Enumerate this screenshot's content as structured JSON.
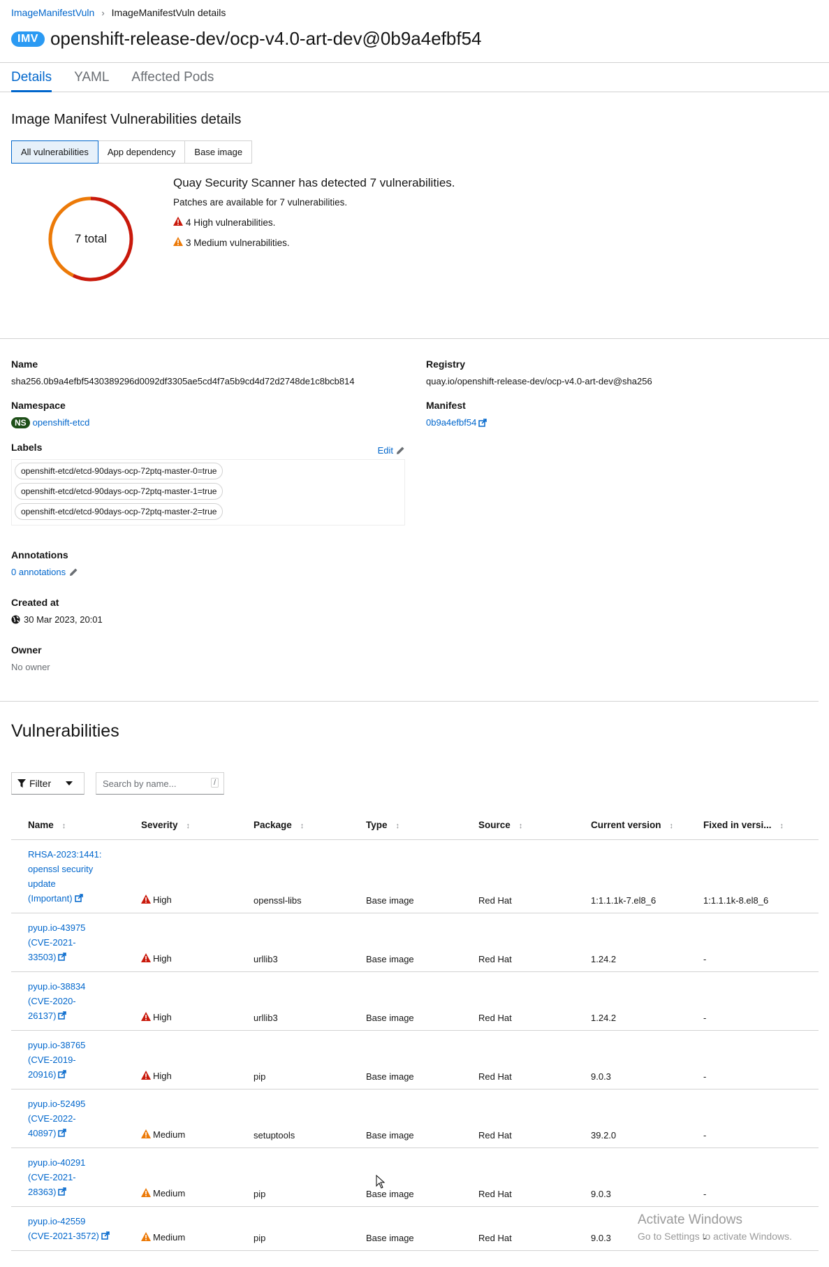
{
  "breadcrumb": {
    "parent": "ImageManifestVuln",
    "current": "ImageManifestVuln details"
  },
  "header": {
    "badge": "IMV",
    "title": "openshift-release-dev/ocp-v4.0-art-dev@0b9a4efbf54"
  },
  "tabs": [
    {
      "label": "Details"
    },
    {
      "label": "YAML"
    },
    {
      "label": "Affected Pods"
    }
  ],
  "details": {
    "heading": "Image Manifest Vulnerabilities details",
    "toggles": [
      {
        "label": "All vulnerabilities"
      },
      {
        "label": "App dependency"
      },
      {
        "label": "Base image"
      }
    ],
    "donut_label": "7 total",
    "donut_data": {
      "total": 7,
      "high": 4,
      "medium": 3,
      "high_color": "#c9190b",
      "medium_color": "#ec7a08"
    },
    "summary_title": "Quay Security Scanner has detected 7 vulnerabilities.",
    "patches": "Patches are available for 7 vulnerabilities.",
    "high_count": "4",
    "high_text": "High vulnerabilities.",
    "medium_count": "3",
    "medium_text": "Medium vulnerabilities."
  },
  "resource": {
    "name_label": "Name",
    "name_value": "sha256.0b9a4efbf5430389296d0092df3305ae5cd4f7a5b9cd4d72d2748de1c8bcb814",
    "registry_label": "Registry",
    "registry_value": "quay.io/openshift-release-dev/ocp-v4.0-art-dev@sha256",
    "namespace_label": "Namespace",
    "namespace_badge": "NS",
    "namespace_value": "openshift-etcd",
    "manifest_label": "Manifest",
    "manifest_value": "0b9a4efbf54",
    "labels_label": "Labels",
    "labels_edit": "Edit",
    "labels": [
      "openshift-etcd/etcd-90days-ocp-72ptq-master-0=true",
      "openshift-etcd/etcd-90days-ocp-72ptq-master-1=true",
      "openshift-etcd/etcd-90days-ocp-72ptq-master-2=true"
    ],
    "annotations_label": "Annotations",
    "annotations_value": "0 annotations",
    "created_label": "Created at",
    "created_value": "30 Mar 2023, 20:01",
    "owner_label": "Owner",
    "owner_value": "No owner"
  },
  "vulnerabilities": {
    "heading": "Vulnerabilities",
    "filter_label": "Filter",
    "search_placeholder": "Search by name...",
    "search_shortcut": "/",
    "columns": [
      "Name",
      "Severity",
      "Package",
      "Type",
      "Source",
      "Current version",
      "Fixed in versi..."
    ],
    "rows": [
      {
        "name": [
          "RHSA-2023:1441:",
          "openssl security",
          "update",
          "(Important)"
        ],
        "severity": "High",
        "package": "openssl-libs",
        "type": "Base image",
        "source": "Red Hat",
        "current": "1:1.1.1k-7.el8_6",
        "fixed": "1:1.1.1k-8.el8_6"
      },
      {
        "name": [
          "pyup.io-43975",
          "(CVE-2021-",
          "33503)"
        ],
        "severity": "High",
        "package": "urllib3",
        "type": "Base image",
        "source": "Red Hat",
        "current": "1.24.2",
        "fixed": "-"
      },
      {
        "name": [
          "pyup.io-38834",
          "(CVE-2020-",
          "26137)"
        ],
        "severity": "High",
        "package": "urllib3",
        "type": "Base image",
        "source": "Red Hat",
        "current": "1.24.2",
        "fixed": "-"
      },
      {
        "name": [
          "pyup.io-38765",
          "(CVE-2019-",
          "20916)"
        ],
        "severity": "High",
        "package": "pip",
        "type": "Base image",
        "source": "Red Hat",
        "current": "9.0.3",
        "fixed": "-"
      },
      {
        "name": [
          "pyup.io-52495",
          "(CVE-2022-",
          "40897)"
        ],
        "severity": "Medium",
        "package": "setuptools",
        "type": "Base image",
        "source": "Red Hat",
        "current": "39.2.0",
        "fixed": "-"
      },
      {
        "name": [
          "pyup.io-40291",
          "(CVE-2021-",
          "28363)"
        ],
        "severity": "Medium",
        "package": "pip",
        "type": "Base image",
        "source": "Red Hat",
        "current": "9.0.3",
        "fixed": "-"
      },
      {
        "name": [
          "pyup.io-42559",
          "(CVE-2021-3572)"
        ],
        "severity": "Medium",
        "package": "pip",
        "type": "Base image",
        "source": "Red Hat",
        "current": "9.0.3",
        "fixed": "-"
      }
    ]
  },
  "watermark": {
    "line1": "Activate Windows",
    "line2": "Go to Settings to activate Windows."
  },
  "colors": {
    "link": "#0066cc",
    "high": "#c9190b",
    "medium": "#ec7a08",
    "ns_badge": "#1e4f18",
    "imv_badge": "#2b9af3"
  }
}
